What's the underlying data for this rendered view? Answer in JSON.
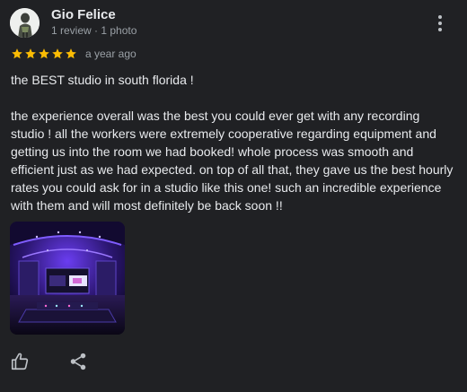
{
  "review": {
    "author": {
      "name": "Gio Felice",
      "meta": "1 review · 1 photo",
      "avatar_icon": "reviewer-avatar"
    },
    "rating": 5,
    "rating_max": 5,
    "star_color": "#fbbc04",
    "date": "a year ago",
    "paragraphs": [
      "the BEST studio in south florida !",
      "the experience overall was the best you could ever get with any recording studio ! all the workers were extremely cooperative regarding equipment and getting us into the room we had booked! whole process was smooth and efficient just as we had expected. on top of all that, they gave us the best hourly rates you could ask for in a studio like this one! such an incredible experience with them and will most definitely be back soon !!"
    ],
    "photo": {
      "accent_color": "#7a3cff"
    },
    "actions": {
      "like_icon": "thumbs-up-icon",
      "share_icon": "share-icon",
      "more_icon": "more-vertical-icon"
    }
  }
}
